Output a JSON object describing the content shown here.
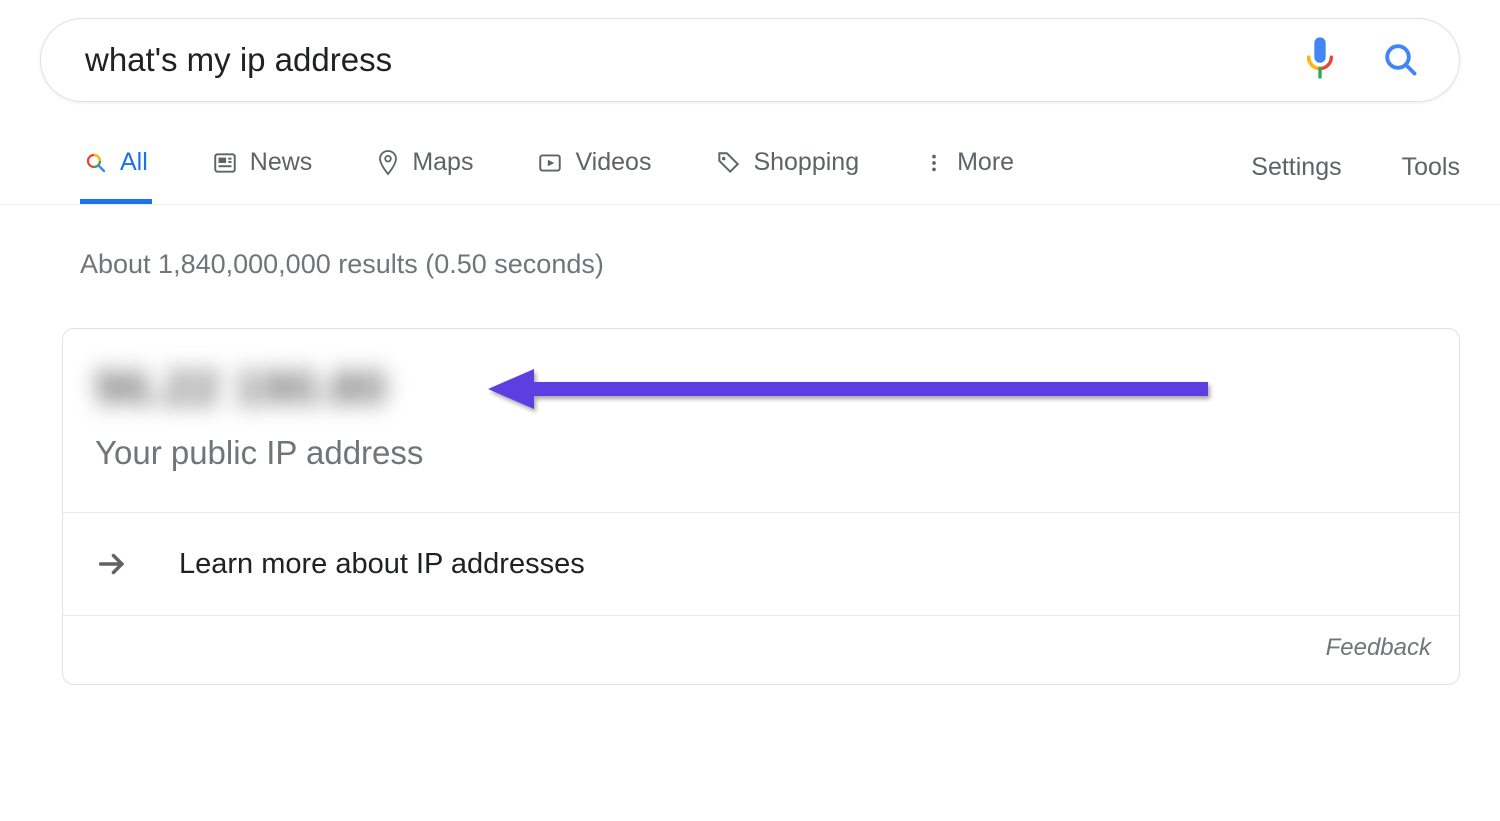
{
  "search": {
    "query": "what's my ip address"
  },
  "tabs": {
    "all": "All",
    "news": "News",
    "maps": "Maps",
    "videos": "Videos",
    "shopping": "Shopping",
    "more": "More",
    "settings": "Settings",
    "tools": "Tools"
  },
  "stats": "About 1,840,000,000 results (0.50 seconds)",
  "card": {
    "ip_blurred": "96.22 190.80",
    "label": "Your public IP address",
    "learn_more": "Learn more about IP addresses",
    "feedback": "Feedback"
  },
  "colors": {
    "link_blue": "#1a73e8",
    "grey_text": "#70757a",
    "arrow": "#5c3fe0"
  }
}
